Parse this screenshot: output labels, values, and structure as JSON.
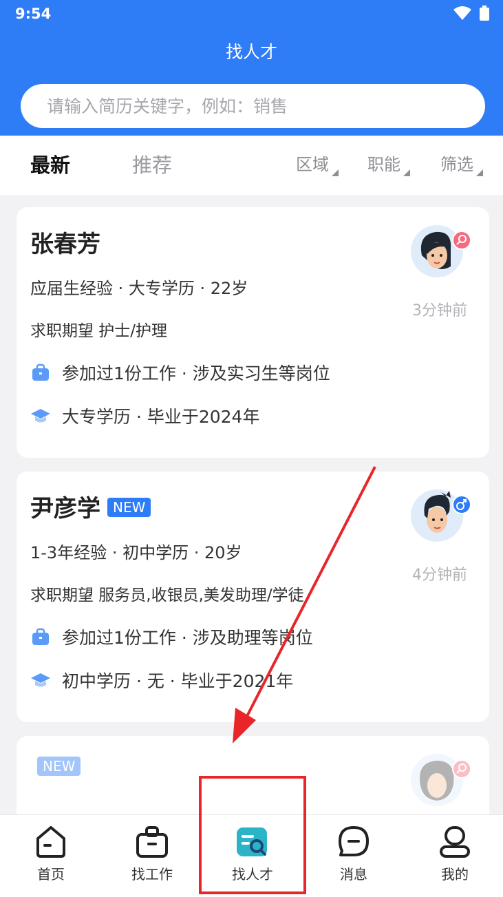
{
  "status": {
    "time": "9:54"
  },
  "header": {
    "title": "找人才"
  },
  "search": {
    "placeholder": "请输入简历关键字，例如：销售"
  },
  "tabs": [
    {
      "label": "最新"
    },
    {
      "label": "推荐"
    }
  ],
  "filters": [
    {
      "label": "区域"
    },
    {
      "label": "职能"
    },
    {
      "label": "筛选"
    }
  ],
  "candidates": [
    {
      "name": "张春芳",
      "basic": "应届生经验 · 大专学历 · 22岁",
      "expectation": "求职期望 护士/护理",
      "experience": "参加过1份工作 · 涉及实习生等岗位",
      "education": "大专学历 · 毕业于2024年",
      "time_ago": "3分钟前",
      "gender": "female"
    },
    {
      "name": "尹彦学",
      "tag": "NEW",
      "basic": "1-3年经验 · 初中学历 · 20岁",
      "expectation": "求职期望 服务员,收银员,美发助理/学徒",
      "experience": "参加过1份工作 · 涉及助理等岗位",
      "education": "初中学历 · 无 · 毕业于2021年",
      "time_ago": "4分钟前",
      "gender": "male"
    },
    {
      "tag": "NEW",
      "gender": "female"
    }
  ],
  "bottom_nav": [
    {
      "label": "首页",
      "icon": "home-icon"
    },
    {
      "label": "找工作",
      "icon": "briefcase-icon"
    },
    {
      "label": "找人才",
      "icon": "talent-search-icon",
      "active": true
    },
    {
      "label": "消息",
      "icon": "message-icon"
    },
    {
      "label": "我的",
      "icon": "profile-icon"
    }
  ],
  "colors": {
    "primary": "#2f7df6",
    "annotation": "#e8262a"
  }
}
